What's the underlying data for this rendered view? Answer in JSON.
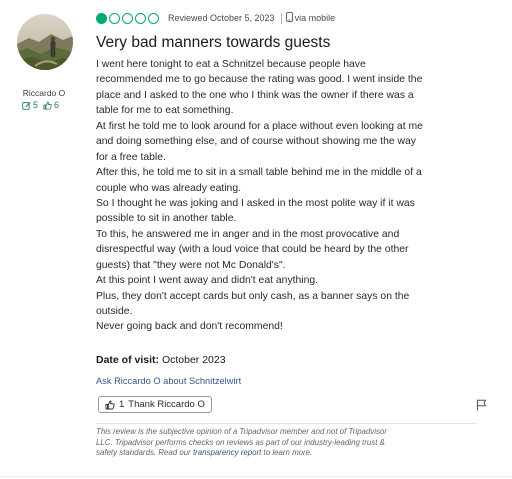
{
  "user": {
    "name": "Riccardo O",
    "contributions": "5",
    "helpful_votes": "6"
  },
  "review": {
    "rating_filled": 1,
    "rating_total": 5,
    "reviewed_date": "Reviewed October 5, 2023",
    "source": "via mobile",
    "title": "Very bad manners towards guests",
    "body_lines": [
      "I went here tonight to eat a Schnitzel because people have",
      "recommended me to go because the rating was good. I went inside the",
      "place and I asked to the one who I think was the owner if there was a",
      "table for me to eat something.",
      "At first he told me to look around for a place without even looking at me",
      "and doing something else, and of course without showing me the way",
      "for a free table.",
      "After this, he told me to sit in a small table behind me in the middle of a",
      "couple who was already eating.",
      "So I thought he was joking and I asked in the most polite way if it was",
      "possible to sit in another table.",
      "To this, he answered me in anger and in the most provocative and",
      "disrespectful way (with a loud voice that could be heard by the other",
      "guests) that \"they were not Mc Donald's\".",
      "At this point I went away and didn't eat anything.",
      "Plus, they don't accept cards but only cash, as a banner says on the",
      "outside.",
      "Never going back and don't recommend!"
    ],
    "visit_label": "Date of visit:",
    "visit_value": "October 2023",
    "ask_link": "Ask Riccardo O about Schnitzelwirt",
    "thank_count": "1",
    "thank_label": "Thank Riccardo O"
  },
  "disclaimer": {
    "line1": "This review is the subjective opinion of a Tripadvisor member and not of Tripadvisor",
    "line2": "LLC. Tripadvisor performs checks on reviews as part of our industry-leading trust &",
    "line3_pre": "safety standards. Read our ",
    "link": "transparency report",
    "line3_post": " to learn more."
  },
  "colors": {
    "bubble": "#00aa6c",
    "stats": "#2f7d4f",
    "link": "#2f5a8a"
  },
  "icons": {
    "contributions": "pencil-square-icon",
    "helpful": "thumbs-up-icon",
    "device": "phone-icon",
    "report": "flag-icon"
  }
}
